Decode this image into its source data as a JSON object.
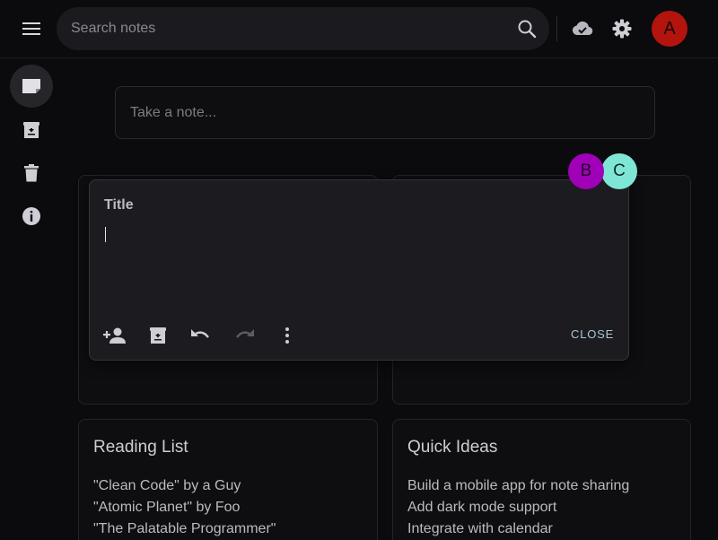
{
  "header": {
    "search_placeholder": "Search notes",
    "avatar_initial": "A",
    "icons": [
      "menu-icon",
      "search-icon",
      "cloud-done-icon",
      "gear-icon"
    ]
  },
  "sidebar": {
    "items": [
      {
        "icon": "note-icon",
        "active": true
      },
      {
        "icon": "archive-icon",
        "active": false
      },
      {
        "icon": "trash-icon",
        "active": false
      },
      {
        "icon": "info-icon",
        "active": false
      }
    ]
  },
  "composer": {
    "placeholder": "Take a note..."
  },
  "editor": {
    "title": "Title",
    "body": "",
    "close_label": "CLOSE",
    "toolbar_icons": [
      "add-collaborator-icon",
      "archive-icon",
      "undo-icon",
      "redo-icon",
      "more-vert-icon"
    ]
  },
  "collaborators": [
    "B",
    "C"
  ],
  "notes": [
    {
      "title": "Reading List",
      "lines": [
        "\"Clean Code\" by a Guy",
        "\"Atomic Planet\" by Foo",
        "\"The Palatable Programmer\""
      ]
    },
    {
      "title": "Quick Ideas",
      "lines": [
        "Build a mobile app for note sharing",
        "Add dark mode support",
        "Integrate with calendar"
      ]
    }
  ],
  "colors": {
    "background": "#0b0a0d",
    "avatar_a": "#b3140e",
    "avatar_b": "#a000b8",
    "avatar_c": "#7fe6d6",
    "close_text": "#aac8d2"
  }
}
